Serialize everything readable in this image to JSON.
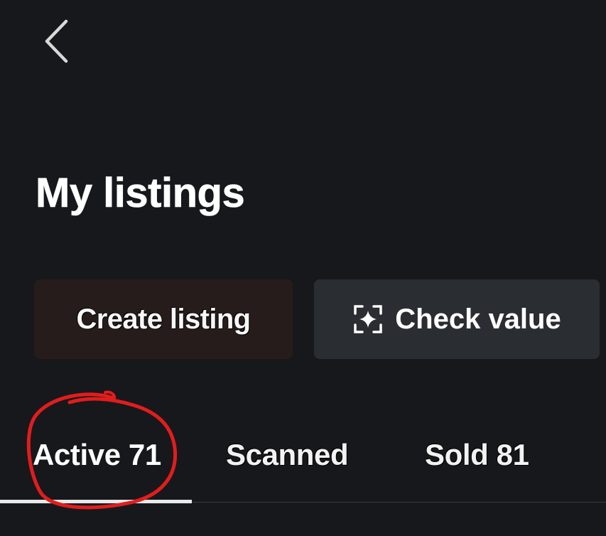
{
  "header": {
    "back_icon": "chevron-left-icon"
  },
  "page": {
    "title": "My listings"
  },
  "actions": {
    "create_label": "Create listing",
    "check_label": "Check value",
    "check_icon": "sparkle-scan-icon"
  },
  "tabs": [
    {
      "label": "Active 71",
      "selected": true
    },
    {
      "label": "Scanned",
      "selected": false
    },
    {
      "label": "Sold 81",
      "selected": false
    }
  ],
  "colors": {
    "background": "#17181c",
    "create_button": "#261c1b",
    "check_button": "#2a2d32",
    "tab_indicator": "#e9e9e9",
    "annotation": "#e11d1d"
  }
}
